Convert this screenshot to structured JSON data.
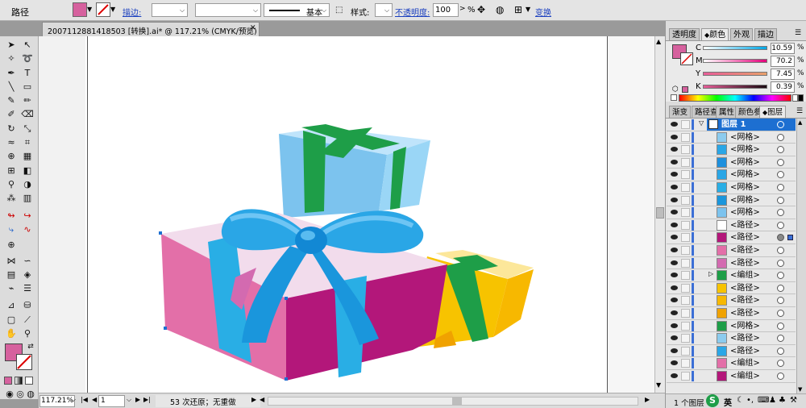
{
  "control": {
    "object_type": "路径",
    "stroke_label": "描边:",
    "brush_label": "基本",
    "style_label": "样式:",
    "opacity_label": "不透明度:",
    "opacity_value": "100",
    "opacity_unit": "%",
    "transform_label": "变换",
    "fill_color": "#d6619e"
  },
  "document": {
    "tab_title": "2007112881418503 [转换].ai* @ 117.21% (CMYK/预览)",
    "close_glyph": "✕"
  },
  "color_panel": {
    "tabs": [
      "透明度",
      "颜色",
      "外观",
      "描边"
    ],
    "active_tab": "颜色",
    "channels": [
      {
        "label": "C",
        "value": "10.59",
        "unit": "%"
      },
      {
        "label": "M",
        "value": "70.2",
        "unit": "%"
      },
      {
        "label": "Y",
        "value": "7.45",
        "unit": "%"
      },
      {
        "label": "K",
        "value": "0.39",
        "unit": "%"
      }
    ]
  },
  "layers_panel": {
    "tabs": [
      "渐变",
      "路径查",
      "属性",
      "颜色参",
      "图层"
    ],
    "active_tab": "图层",
    "layer_name": "图层 1",
    "items": [
      "<网格>",
      "<网格>",
      "<网格>",
      "<网格>",
      "<网格>",
      "<网格>",
      "<网格>",
      "<路径>",
      "<路径>",
      "<路径>",
      "<路径>",
      "<编组>",
      "<路径>",
      "<路径>",
      "<路径>",
      "<网格>",
      "<路径>",
      "<路径>",
      "<编组>",
      "<编组>"
    ],
    "footer_text": "1 个图层",
    "ime_label": "英"
  },
  "status": {
    "zoom": "117.21%",
    "page": "1",
    "message": "53 次还原；无重做"
  },
  "colors": {
    "accent_link": "#1a3fbf",
    "selection_blue": "#1d6fd1",
    "layer_bar_blue": "#3b6fd6"
  }
}
